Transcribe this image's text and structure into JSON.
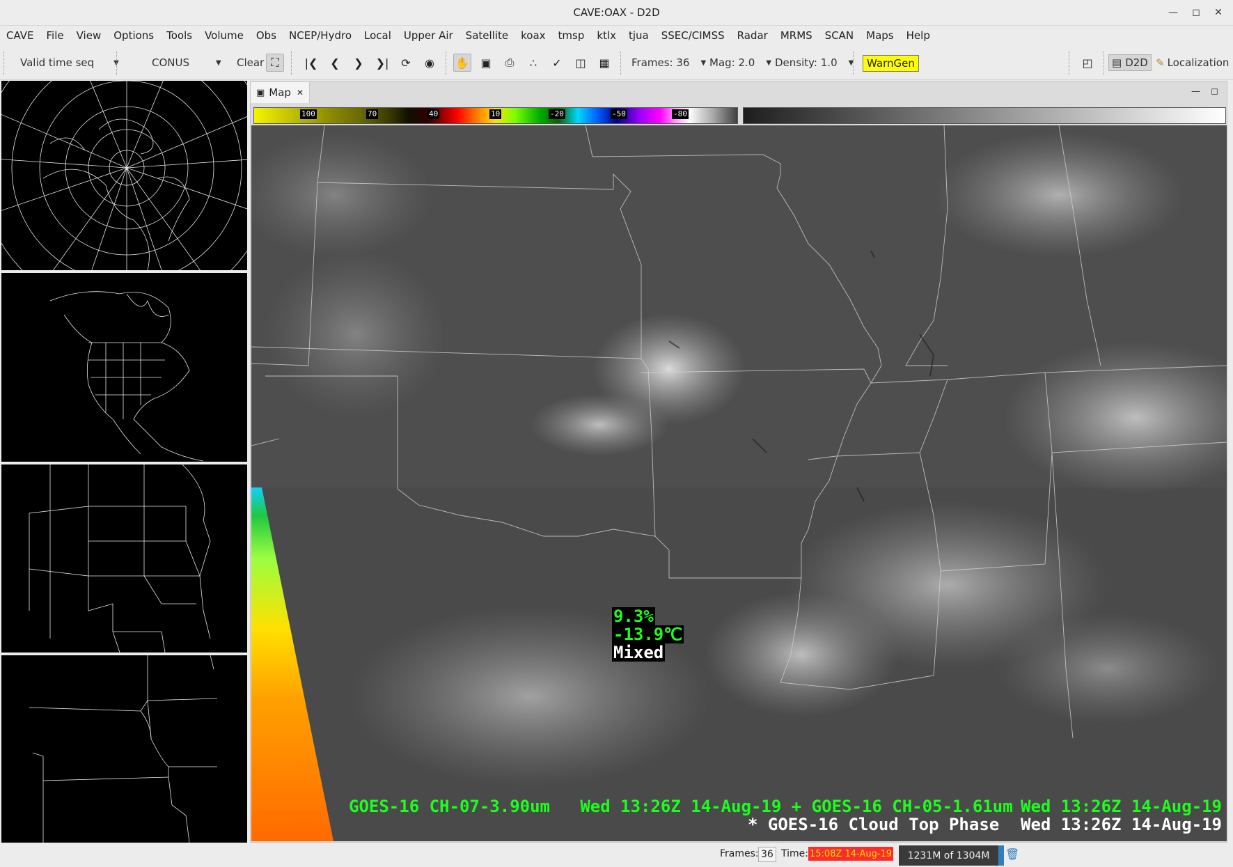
{
  "window": {
    "title": "CAVE:OAX - D2D"
  },
  "menubar": [
    "CAVE",
    "File",
    "View",
    "Options",
    "Tools",
    "Volume",
    "Obs",
    "NCEP/Hydro",
    "Local",
    "Upper Air",
    "Satellite",
    "koax",
    "tmsp",
    "ktlx",
    "tjua",
    "SSEC/CIMSS",
    "Radar",
    "MRMS",
    "SCAN",
    "Maps",
    "Help"
  ],
  "toolbar": {
    "time_mode": "Valid time seq",
    "scale": "CONUS",
    "clear_label": "Clear",
    "frames_label": "Frames: 36",
    "mag_label": "Mag: 2.0",
    "density_label": "Density: 1.0",
    "warngen_label": "WarnGen",
    "perspective_d2d": "D2D",
    "perspective_localization": "Localization"
  },
  "map_tab": {
    "label": "Map"
  },
  "colorbar": {
    "labels": [
      "100",
      "70",
      "40",
      "10",
      "-20",
      "-50",
      "-80"
    ]
  },
  "sample_readout": {
    "line1": "9.3%",
    "line2": "-13.9℃",
    "line3": "Mixed"
  },
  "legend": {
    "line1_product": "GOES-16 CH-07-3.90um   Wed 13:26Z 14-Aug-19 + GOES-16 CH-05-1.61um",
    "line1_time": "Wed 13:26Z 14-Aug-19",
    "line2_product": "* GOES-16 Cloud Top Phase",
    "line2_time": "Wed 13:26Z 14-Aug-19"
  },
  "colors": {
    "legend_green": "#1cff1c",
    "warngen_bg": "#ffff00",
    "time_alert_bg": "#ff2a2a"
  },
  "statusbar": {
    "frames_label": "Frames:",
    "frames_value": "36",
    "time_label": "Time:",
    "time_value": "15:08Z 14-Aug-19",
    "memory": "1231M of 1304M"
  }
}
